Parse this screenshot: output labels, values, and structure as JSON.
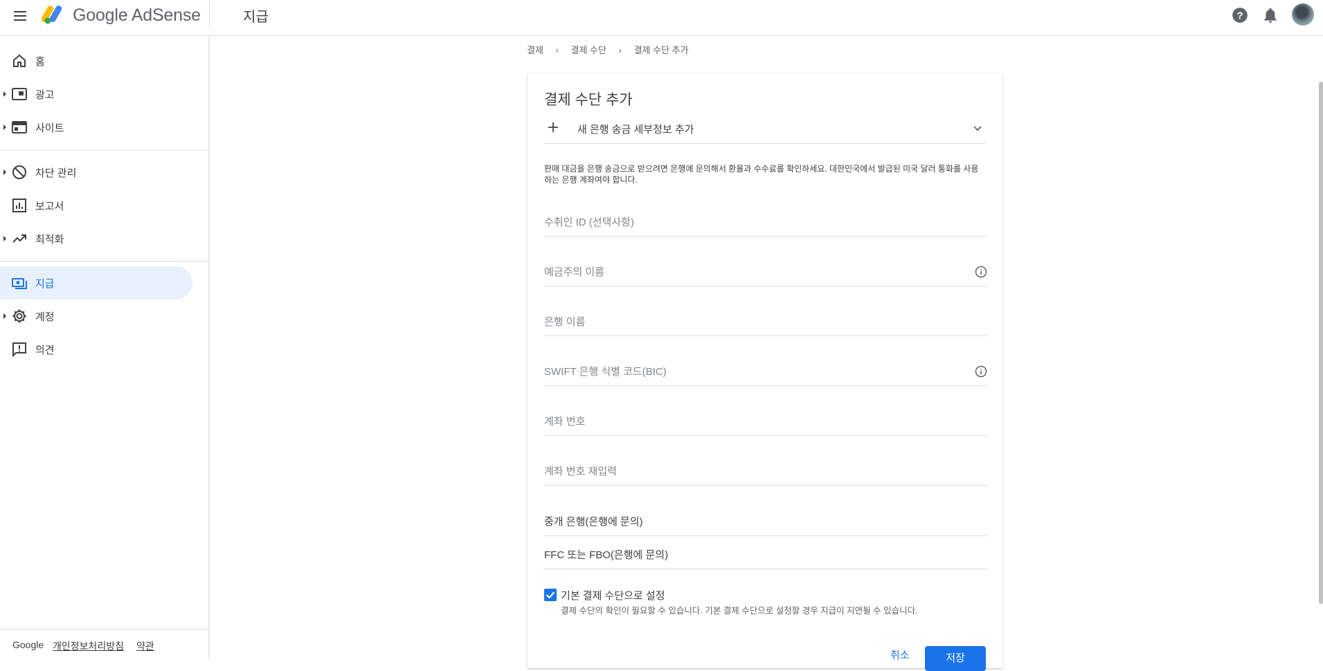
{
  "app": {
    "brand": "Google AdSense",
    "page_title": "지급"
  },
  "sidebar": {
    "items": [
      {
        "label": "홈",
        "icon": "home-icon",
        "caret": false,
        "active": false
      },
      {
        "label": "광고",
        "icon": "ads-icon",
        "caret": true,
        "active": false
      },
      {
        "label": "사이트",
        "icon": "sites-icon",
        "caret": true,
        "active": false
      },
      {
        "label": "차단 관리",
        "icon": "block-icon",
        "caret": true,
        "active": false
      },
      {
        "label": "보고서",
        "icon": "reports-icon",
        "caret": false,
        "active": false
      },
      {
        "label": "최적화",
        "icon": "trending-up-icon",
        "caret": true,
        "active": false
      },
      {
        "label": "지급",
        "icon": "payments-icon",
        "caret": false,
        "active": true
      },
      {
        "label": "계정",
        "icon": "gear-icon",
        "caret": true,
        "active": false
      },
      {
        "label": "의견",
        "icon": "feedback-icon",
        "caret": false,
        "active": false
      }
    ],
    "footer": {
      "google": "Google",
      "privacy": "개인정보처리방침",
      "terms": "약관"
    }
  },
  "breadcrumb": [
    "결제",
    "결제 수단",
    "결제 수단 추가"
  ],
  "card": {
    "title": "결제 수단 추가",
    "method_label": "새 은행 송금 세부정보 추가",
    "description": "판매 대금을 은행 송금으로 받으려면 은행에 문의해서 환율과 수수료를 확인하세요. 대한민국에서 발급된 미국 달러 통화를 사용하는 은행 계좌여야 합니다.",
    "fields": {
      "payee_id": "수취인 ID (선택사항)",
      "account_holder": "예금주의 이름",
      "bank_name": "은행 이름",
      "swift": "SWIFT 은행 식별 코드(BIC)",
      "account_number": "계좌 번호",
      "account_number_confirm": "계좌 번호 재입력",
      "intermediary_bank": "중개 은행(은행에 문의)",
      "ffc_fbo": "FFC 또는 FBO(은행에 문의)"
    },
    "default_checkbox": {
      "checked": true,
      "label": "기본 결제 수단으로 설정",
      "sublabel": "결제 수단의 확인이 필요할 수 있습니다. 기본 결제 수단으로 설정할 경우 지급이 지연될 수 있습니다."
    },
    "cancel_label": "취소",
    "save_label": "저장"
  },
  "colors": {
    "accent": "#1a73e8",
    "active_bg": "#e8f0fe"
  }
}
